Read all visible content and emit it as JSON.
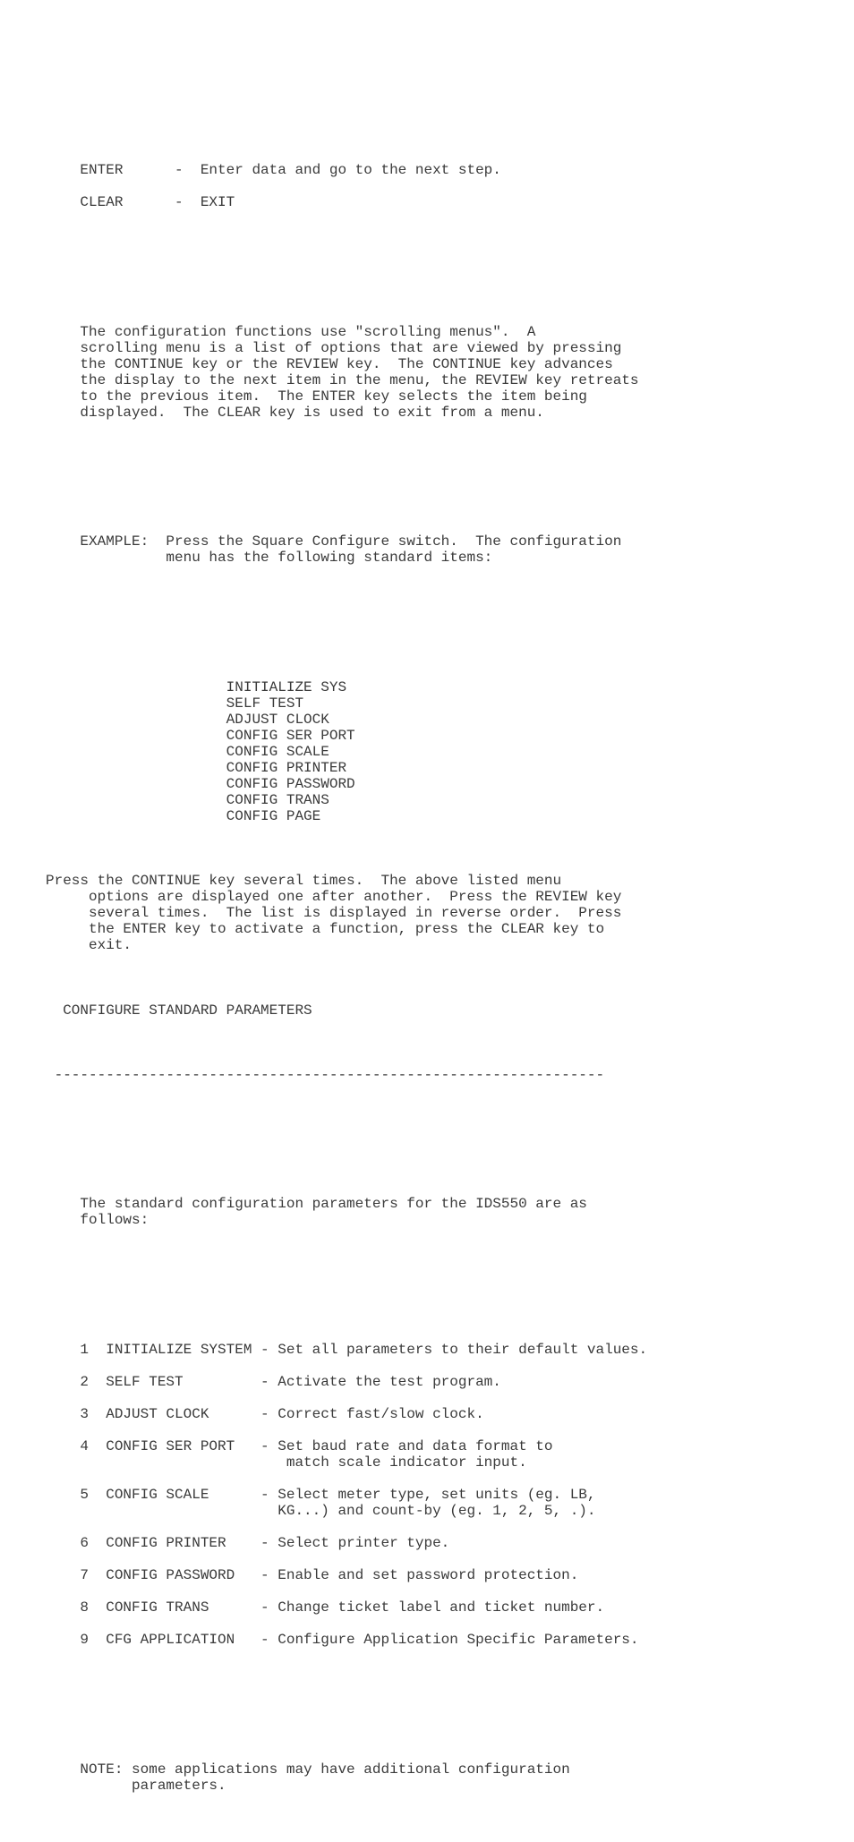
{
  "document": {
    "type": "plain-text-manual-page",
    "device": "IDS550",
    "text_color": "#3a3a3a",
    "background_color": "#ffffff",
    "key_legend": [
      {
        "key": "ENTER",
        "separator": "-",
        "description": "Enter data and go to the next step."
      },
      {
        "key": "CLEAR",
        "separator": "-",
        "description": "EXIT"
      }
    ],
    "key_legend_lines": [
      "    ENTER      -  Enter data and go to the next step.",
      "",
      "    CLEAR      -  EXIT"
    ],
    "scrolling_menus_paragraph": [
      "    The configuration functions use \"scrolling menus\".  A",
      "    scrolling menu is a list of options that are viewed by pressing",
      "    the CONTINUE key or the REVIEW key.  The CONTINUE key advances",
      "    the display to the next item in the menu, the REVIEW key retreats",
      "    to the previous item.  The ENTER key selects the item being",
      "    displayed.  The CLEAR key is used to exit from a menu."
    ],
    "example_intro": [
      "    EXAMPLE:  Press the Square Configure switch.  The configuration",
      "              menu has the following standard items:"
    ],
    "example_menu_items": [
      "INITIALIZE SYS",
      "SELF TEST",
      "ADJUST CLOCK",
      "CONFIG SER PORT",
      "CONFIG SCALE",
      "CONFIG PRINTER",
      "CONFIG PASSWORD",
      "CONFIG TRANS",
      "CONFIG PAGE"
    ],
    "example_menu_lines": [
      "                     INITIALIZE SYS",
      "                     SELF TEST",
      "                     ADJUST CLOCK",
      "                     CONFIG SER PORT",
      "                     CONFIG SCALE",
      "                     CONFIG PRINTER",
      "                     CONFIG PASSWORD",
      "                     CONFIG TRANS",
      "                     CONFIG PAGE"
    ],
    "continue_key_paragraph": [
      "Press the CONTINUE key several times.  The above listed menu",
      "     options are displayed one after another.  Press the REVIEW key",
      "     several times.  The list is displayed in reverse order.  Press",
      "     the ENTER key to activate a function, press the CLEAR key to",
      "     exit."
    ],
    "section_heading": "  CONFIGURE STANDARD PARAMETERS",
    "section_heading_text": "CONFIGURE STANDARD PARAMETERS",
    "section_rule": " ----------------------------------------------------------------",
    "standard_params_intro": [
      "    The standard configuration parameters for the IDS550 are as",
      "    follows:"
    ],
    "standard_parameters": [
      {
        "number": "1",
        "name": "INITIALIZE SYSTEM",
        "separator": "-",
        "description": "Set all parameters to their default values.",
        "description_cont": ""
      },
      {
        "number": "2",
        "name": "SELF TEST",
        "separator": "-",
        "description": "Activate the test program.",
        "description_cont": ""
      },
      {
        "number": "3",
        "name": "ADJUST CLOCK",
        "separator": "-",
        "description": "Correct fast/slow clock.",
        "description_cont": ""
      },
      {
        "number": "4",
        "name": "CONFIG SER PORT",
        "separator": "-",
        "description": "Set baud rate and data format to",
        "description_cont": "match scale indicator input."
      },
      {
        "number": "5",
        "name": "CONFIG SCALE",
        "separator": "-",
        "description": "Select meter type, set units (eg. LB,",
        "description_cont": "KG...) and count-by (eg. 1, 2, 5, .)."
      },
      {
        "number": "6",
        "name": "CONFIG PRINTER",
        "separator": "-",
        "description": "Select printer type.",
        "description_cont": ""
      },
      {
        "number": "7",
        "name": "CONFIG PASSWORD",
        "separator": "-",
        "description": "Enable and set password protection.",
        "description_cont": ""
      },
      {
        "number": "8",
        "name": "CONFIG TRANS",
        "separator": "-",
        "description": "Change ticket label and ticket number.",
        "description_cont": ""
      },
      {
        "number": "9",
        "name": "CFG APPLICATION",
        "separator": "-",
        "description": "Configure Application Specific Parameters.",
        "description_cont": ""
      }
    ],
    "standard_parameters_lines": [
      "    1  INITIALIZE SYSTEM - Set all parameters to their default values.",
      "",
      "    2  SELF TEST         - Activate the test program.",
      "",
      "    3  ADJUST CLOCK      - Correct fast/slow clock.",
      "",
      "    4  CONFIG SER PORT   - Set baud rate and data format to",
      "                            match scale indicator input.",
      "",
      "    5  CONFIG SCALE      - Select meter type, set units (eg. LB,",
      "                           KG...) and count-by (eg. 1, 2, 5, .).",
      "",
      "    6  CONFIG PRINTER    - Select printer type.",
      "",
      "    7  CONFIG PASSWORD   - Enable and set password protection.",
      "",
      "    8  CONFIG TRANS      - Change ticket label and ticket number.",
      "",
      "    9  CFG APPLICATION   - Configure Application Specific Parameters."
    ],
    "note": [
      "    NOTE: some applications may have additional configuration",
      "          parameters."
    ],
    "note_label": "NOTE:",
    "note_text": "some applications may have additional configuration parameters."
  }
}
